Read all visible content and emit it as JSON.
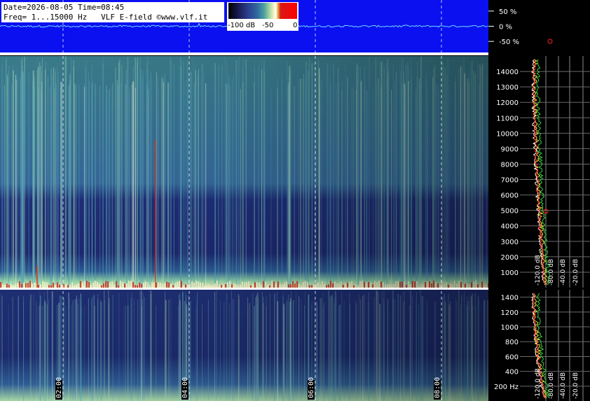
{
  "info": {
    "line1": "Date=2026-08-05 Time=08:45",
    "line2": "Freq= 1...15000 Hz   VLF E-field ©www.vlf.it"
  },
  "color_scale": {
    "labels": [
      "-100 dB",
      "-50",
      "0"
    ],
    "colors": [
      "#000000",
      "#2a3d8c",
      "#4fa0a0",
      "#f4f2c0",
      "#d81818",
      "#ff0000"
    ]
  },
  "colors": {
    "waveform_bg": "#0a10f0",
    "waveform_trace": "#6fd8ff",
    "spectrum_trace_avg": "#ffffff",
    "spectrum_trace_peak": "#e8e830",
    "spectrum_trace_alt": "#30d040",
    "marker": "#ff2020"
  },
  "chart_data": [
    {
      "type": "line",
      "title": "",
      "ylabel": "%",
      "y_ticks": [
        "50 %",
        "0 %",
        "-50 %"
      ],
      "ylim": [
        -75,
        75
      ],
      "series": [
        {
          "values": [
            0,
            3,
            -2,
            4,
            -3,
            2,
            -1,
            5,
            -4,
            1,
            0,
            2,
            -2,
            3,
            -1,
            0,
            1,
            -3,
            2,
            0
          ]
        }
      ]
    },
    {
      "type": "heatmap",
      "xlabel": "",
      "ylabel": "",
      "x_ticks": [
        "02:00",
        "04:00",
        "06:00",
        "08:00"
      ],
      "y_ticks": [
        "1000",
        "2000",
        "3000",
        "4000",
        "5000",
        "6000",
        "7000",
        "8000",
        "9000",
        "10000",
        "11000",
        "12000",
        "13000",
        "14000"
      ],
      "ylim": [
        1,
        15000
      ],
      "grid": true
    },
    {
      "type": "line",
      "xlabel": "",
      "x_ticks": [
        "-120.0 dB",
        "-80.0 dB",
        "-40.0 dB",
        "-20.0 dB"
      ],
      "y_ticks": [
        "1000",
        "2000",
        "3000",
        "4000",
        "5000",
        "6000",
        "7000",
        "8000",
        "9000",
        "10000",
        "11000",
        "12000",
        "13000",
        "14000"
      ],
      "ylim": [
        1,
        15000
      ]
    },
    {
      "type": "heatmap",
      "x_ticks": [
        "02:00",
        "04:00",
        "06:00",
        "08:00"
      ],
      "y_ticks": [
        "200 Hz",
        "400",
        "600",
        "800",
        "1000",
        "1200",
        "1400"
      ],
      "ylim": [
        1,
        1500
      ],
      "grid": true
    },
    {
      "type": "line",
      "x_ticks": [
        "-120.0 dB",
        "-80.0 dB",
        "-40.0 dB",
        "-20.0 dB"
      ],
      "y_ticks": [
        "200 Hz",
        "400",
        "600",
        "800",
        "1000",
        "1200",
        "1400"
      ],
      "ylim": [
        1,
        1500
      ]
    }
  ]
}
